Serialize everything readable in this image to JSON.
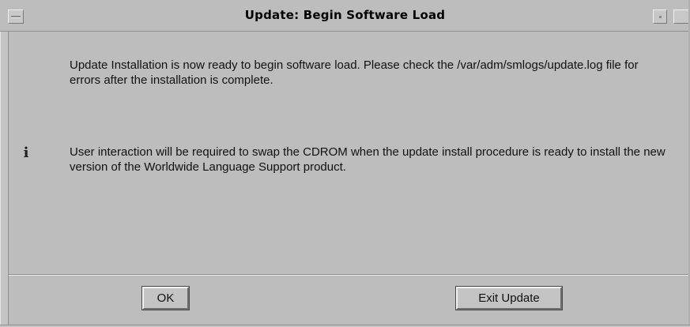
{
  "window": {
    "title": "Update: Begin Software Load"
  },
  "icons": {
    "info": "info-icon",
    "window_menu": "window-menu-icon",
    "minimize": "minimize-icon",
    "maximize": "maximize-icon"
  },
  "messages": [
    "Update Installation is now ready to begin software load. Please check the /var/adm/smlogs/update.log file for errors after the installation is complete.",
    "User interaction will be required to swap the CDROM when the update install procedure is ready to install the new version of the Worldwide Language Support product."
  ],
  "buttons": {
    "ok_label": "OK",
    "exit_label": "Exit Update"
  },
  "info_glyph": "i"
}
